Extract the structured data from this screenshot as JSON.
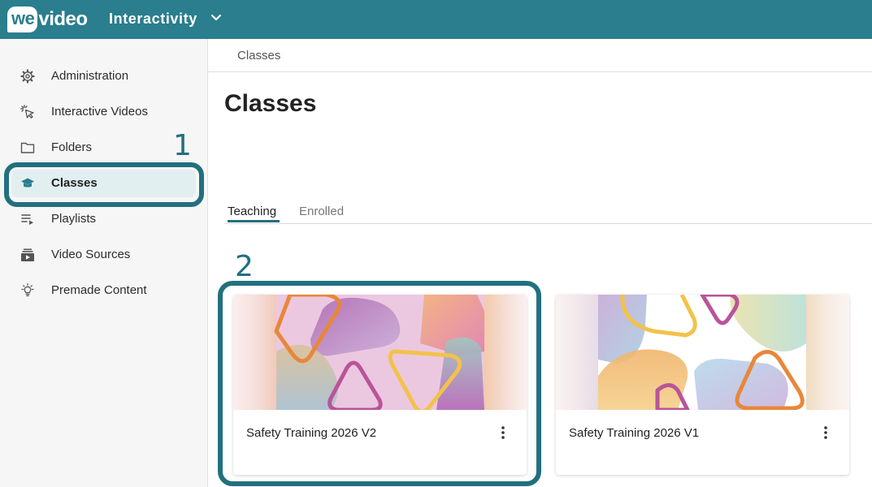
{
  "header": {
    "logo_we": "we",
    "logo_video": "video",
    "workspace_name": "Interactivity",
    "workspace_chevron_icon": "chevron-down-icon"
  },
  "sidebar": {
    "items": [
      {
        "label": "Administration",
        "icon": "gear-icon",
        "active": false
      },
      {
        "label": "Interactive Videos",
        "icon": "click-cursor-icon",
        "active": false
      },
      {
        "label": "Folders",
        "icon": "folder-icon",
        "active": false
      },
      {
        "label": "Classes",
        "icon": "graduation-cap-icon",
        "active": true
      },
      {
        "label": "Playlists",
        "icon": "playlist-icon",
        "active": false
      },
      {
        "label": "Video Sources",
        "icon": "video-library-icon",
        "active": false
      },
      {
        "label": "Premade Content",
        "icon": "lightbulb-icon",
        "active": false
      }
    ]
  },
  "annotations": {
    "marker_1": "1",
    "marker_2": "2"
  },
  "breadcrumb": "Classes",
  "page_title": "Classes",
  "tabs": [
    {
      "label": "Teaching",
      "active": true
    },
    {
      "label": "Enrolled",
      "active": false
    }
  ],
  "cards": [
    {
      "title": "Safety Training 2026 V2",
      "menu_icon": "more-vert-icon"
    },
    {
      "title": "Safety Training 2026 V1",
      "menu_icon": "more-vert-icon"
    }
  ],
  "colors": {
    "brand": "#2a7e8d",
    "highlight": "#21707e",
    "active_bg": "#e2eff1"
  }
}
